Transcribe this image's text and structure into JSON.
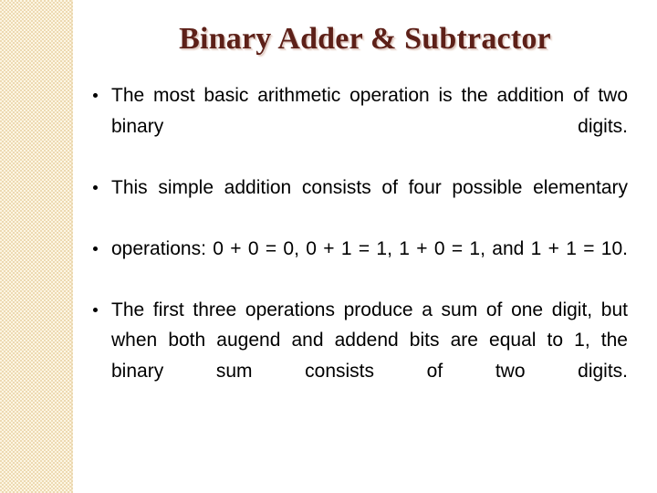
{
  "slide": {
    "title": "Binary Adder & Subtractor",
    "title_color": "#5d2018",
    "background_color": "#ffffff",
    "side_band_color": "#f4e4c1",
    "body_text_color": "#000000",
    "bullets": [
      {
        "marker": "bullet-dot",
        "text": "The most basic arithmetic operation is the addition of two binary digits."
      },
      {
        "marker": "bullet-dot",
        "text": "This simple addition consists of four possible elementary"
      },
      {
        "marker": "bullet-dot",
        "text": "operations: 0 + 0 = 0, 0 + 1 = 1, 1 + 0 = 1, and 1 + 1 = 10."
      },
      {
        "marker": "bullet-dot",
        "text": "The first three operations produce a sum of one digit, but when both augend and addend bits are equal to 1, the binary sum consists of two digits."
      }
    ]
  }
}
